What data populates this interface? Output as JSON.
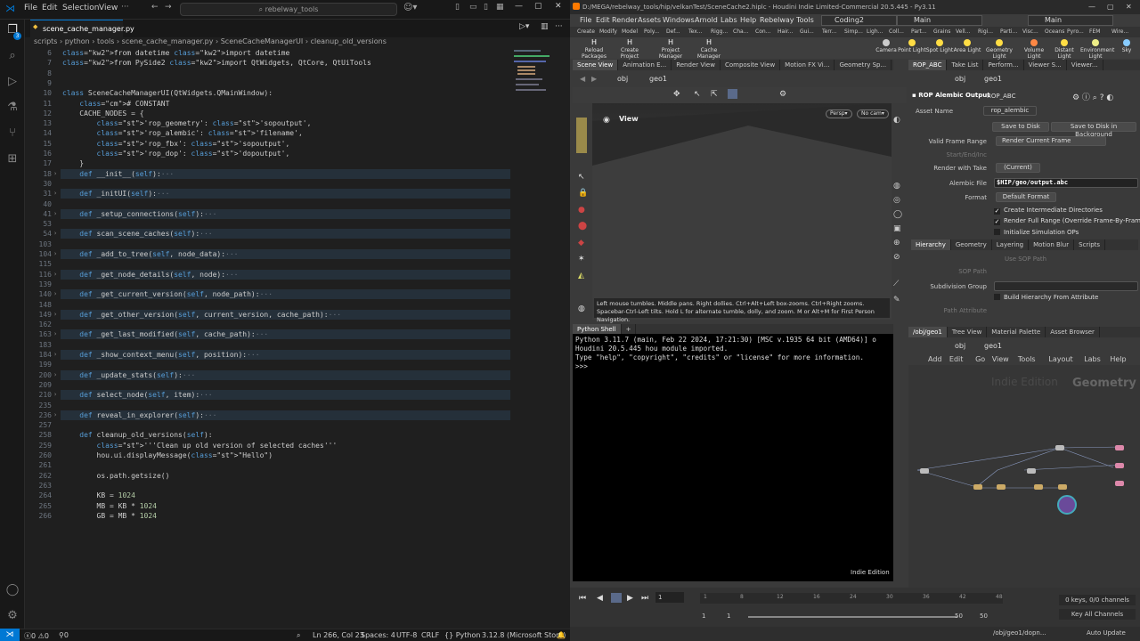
{
  "vscode": {
    "menu": [
      "File",
      "Edit",
      "Selection",
      "View"
    ],
    "search": "rebelway_tools",
    "tab": "scene_cache_manager.py",
    "breadcrumb": [
      "scripts",
      "python",
      "tools",
      "scene_cache_manager.py",
      "SceneCacheManagerUI",
      "cleanup_old_versions"
    ],
    "badge": "3",
    "lines": [
      {
        "n": "6",
        "t": "from datetime import datetime"
      },
      {
        "n": "7",
        "t": "from PySide2 import QtWidgets, QtCore, QtUiTools"
      },
      {
        "n": "8",
        "t": ""
      },
      {
        "n": "9",
        "t": ""
      },
      {
        "n": "10",
        "t": "class SceneCacheManagerUI(QtWidgets.QMainWindow):"
      },
      {
        "n": "11",
        "t": "    # CONSTANT"
      },
      {
        "n": "12",
        "t": "    CACHE_NODES = {"
      },
      {
        "n": "13",
        "t": "        'rop_geometry': 'sopoutput',"
      },
      {
        "n": "14",
        "t": "        'rop_alembic': 'filename',"
      },
      {
        "n": "15",
        "t": "        'rop_fbx': 'sopoutput',"
      },
      {
        "n": "16",
        "t": "        'rop_dop': 'dopoutput',"
      },
      {
        "n": "17",
        "t": "    }"
      },
      {
        "n": "18",
        "t": "    def __init__(self):···",
        "fold": true
      },
      {
        "n": "30",
        "t": ""
      },
      {
        "n": "31",
        "t": "    def _initUI(self):···",
        "fold": true
      },
      {
        "n": "40",
        "t": ""
      },
      {
        "n": "41",
        "t": "    def _setup_connections(self):···",
        "fold": true
      },
      {
        "n": "53",
        "t": ""
      },
      {
        "n": "54",
        "t": "    def scan_scene_caches(self):···",
        "fold": true
      },
      {
        "n": "103",
        "t": ""
      },
      {
        "n": "104",
        "t": "    def _add_to_tree(self, node_data):···",
        "fold": true
      },
      {
        "n": "115",
        "t": ""
      },
      {
        "n": "116",
        "t": "    def _get_node_details(self, node):···",
        "fold": true
      },
      {
        "n": "139",
        "t": ""
      },
      {
        "n": "140",
        "t": "    def _get_current_version(self, node_path):···",
        "fold": true
      },
      {
        "n": "148",
        "t": ""
      },
      {
        "n": "149",
        "t": "    def _get_other_version(self, current_version, cache_path):···",
        "fold": true
      },
      {
        "n": "162",
        "t": ""
      },
      {
        "n": "163",
        "t": "    def _get_last_modified(self, cache_path):···",
        "fold": true
      },
      {
        "n": "183",
        "t": ""
      },
      {
        "n": "184",
        "t": "    def _show_context_menu(self, position):···",
        "fold": true
      },
      {
        "n": "199",
        "t": ""
      },
      {
        "n": "200",
        "t": "    def _update_stats(self):···",
        "fold": true
      },
      {
        "n": "209",
        "t": ""
      },
      {
        "n": "210",
        "t": "    def select_node(self, item):···",
        "fold": true
      },
      {
        "n": "235",
        "t": ""
      },
      {
        "n": "236",
        "t": "    def reveal_in_explorer(self):···",
        "fold": true
      },
      {
        "n": "257",
        "t": ""
      },
      {
        "n": "258",
        "t": "    def cleanup_old_versions(self):"
      },
      {
        "n": "259",
        "t": "        '''Clean up old version of selected caches'''"
      },
      {
        "n": "260",
        "t": "        hou.ui.displayMessage(\"Hello\")"
      },
      {
        "n": "261",
        "t": ""
      },
      {
        "n": "262",
        "t": "        os.path.getsize()"
      },
      {
        "n": "263",
        "t": ""
      },
      {
        "n": "264",
        "t": "        KB = 1024"
      },
      {
        "n": "265",
        "t": "        MB = KB * 1024"
      },
      {
        "n": "266",
        "t": "        GB = MB * 1024"
      }
    ],
    "status": {
      "errors": "0",
      "warnings": "0",
      "ports": "0",
      "position": "Ln 266, Col 23",
      "spaces": "Spaces: 4",
      "encoding": "UTF-8",
      "eol": "CRLF",
      "lang": "Python",
      "interp": "3.12.8 (Microsoft Store)"
    }
  },
  "houdini": {
    "title": "D:/MEGA/rebelway_tools/hip/velkanTest/SceneCache2.hiplc - Houdini Indie Limited-Commercial 20.5.445 - Py3.11",
    "menu": [
      "File",
      "Edit",
      "Render",
      "Assets",
      "Windows",
      "Arnold",
      "Labs",
      "Help",
      "Rebelway Tools"
    ],
    "desktop": "Coding2",
    "main": "Main",
    "main2": "Main",
    "shelf_tabs_left": [
      "Create",
      "Modify",
      "Model",
      "Poly...",
      "Def...",
      "Tex...",
      "Rigg...",
      "Cha...",
      "Con...",
      "Hair...",
      "Gui...",
      "Terr...",
      "Simp..."
    ],
    "shelf_tabs_right": [
      "Ligh...",
      "Coll...",
      "Part...",
      "Grains",
      "Vell...",
      "Rigi...",
      "Parti...",
      "Visc...",
      "Oceans",
      "Pyro...",
      "FEM",
      "Wire..."
    ],
    "tools_left": [
      "Reload Packages a...",
      "Create Project",
      "Project Manager",
      "Cache Manager"
    ],
    "tools_right": [
      "Camera",
      "Point Light",
      "Spot Light",
      "Area Light",
      "Geometry Light",
      "Volume Light",
      "Distant Light",
      "Environment Light",
      "Sky"
    ],
    "view_tabs": [
      "Scene View",
      "Animation E...",
      "Render View",
      "Composite View",
      "Motion FX Vi...",
      "Geometry Sp..."
    ],
    "param_tabs": [
      "ROP_ABC",
      "Take List",
      "Perform...",
      "Viewer S...",
      "Viewer..."
    ],
    "path_obj": "obj",
    "path_geo": "geo1",
    "view_label": "View",
    "persp": "Persp",
    "cam": "No cam",
    "viewport_help": "Left mouse tumbles. Middle pans. Right dollies. Ctrl+Alt+Left box-zooms. Ctrl+Right zooms. Spacebar-Ctrl-Left tilts. Hold L for alternate tumble, dolly, and zoom. M or Alt+M for First Person Navigation.",
    "shell_tab": "Python Shell",
    "shell_lines": [
      "Python 3.11.7 (main, Feb 22 2024, 17:21:30) [MSC v.1935 64 bit (AMD64)] o",
      "Houdini 20.5.445 hou module imported.",
      "Type \"help\", \"copyright\", \"credits\" or \"license\" for more information.",
      ">>>"
    ],
    "indie": "Indie Edition",
    "rop": {
      "type": "ROP Alembic Output",
      "name": "ROP_ABC",
      "asset_label": "Asset Name",
      "asset": "rop_alembic",
      "save": "Save to Disk",
      "save_bg": "Save to Disk in Background",
      "rows": [
        {
          "l": "Valid Frame Range",
          "v": "Render Current Frame"
        },
        {
          "l": "Start/End/Inc",
          "v": ""
        },
        {
          "l": "Render with Take",
          "v": "(Current)"
        },
        {
          "l": "Alembic File",
          "v": "$HIP/geo/output.abc"
        },
        {
          "l": "Format",
          "v": "Default Format"
        }
      ],
      "checks": [
        "Create Intermediate Directories",
        "Render Full Range (Override Frame-By-Frame)",
        "Initialize Simulation OPs"
      ],
      "tabs": [
        "Hierarchy",
        "Geometry",
        "Layering",
        "Motion Blur",
        "Scripts"
      ],
      "use_sop": "Use SOP Path",
      "sop_path": "SOP Path",
      "subdiv": "Subdivision Group",
      "build": "Build Hierarchy From Attribute",
      "attr_path": "Path Attribute"
    },
    "net_tabs": [
      "/obj/geo1",
      "Tree View",
      "Material Palette",
      "Asset Browser"
    ],
    "net_menu": [
      "Add",
      "Edit",
      "Go",
      "View",
      "Tools",
      "Layout",
      "Labs",
      "Help"
    ],
    "net_watermark": "Indie Edition",
    "net_context": "Geometry",
    "timeline": {
      "frame": "1",
      "start": "1",
      "start2": "1",
      "end": "50",
      "end2": "50",
      "keys": "0 keys, 0/0 channels",
      "keyall": "Key All Channels",
      "ticks": [
        "1",
        "8",
        "12",
        "16",
        "24",
        "30",
        "36",
        "42",
        "48"
      ]
    },
    "status_path": "/obj/geo1/dopn...",
    "autoupdate": "Auto Update"
  }
}
